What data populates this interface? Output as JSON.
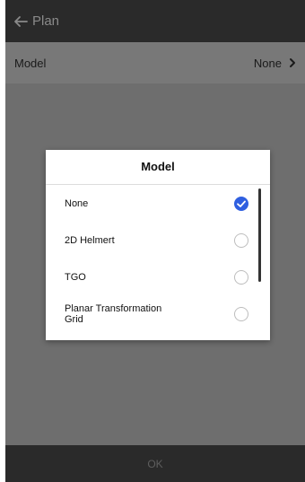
{
  "header": {
    "back_icon": "arrow-left-icon",
    "title": "Plan"
  },
  "settings_row": {
    "label": "Model",
    "value": "None",
    "chevron_icon": "chevron-right-icon"
  },
  "dialog": {
    "title": "Model",
    "selected": "None",
    "options": [
      {
        "label": "None",
        "checked": true
      },
      {
        "label": "2D Helmert",
        "checked": false
      },
      {
        "label": "TGO",
        "checked": false
      },
      {
        "label": "Planar Transformation Grid",
        "checked": false
      }
    ]
  },
  "footer": {
    "ok_label": "OK"
  },
  "colors": {
    "accent": "#2f5fe0",
    "topbar": "#2a2a2a",
    "overlay": "#6e6e6e"
  }
}
